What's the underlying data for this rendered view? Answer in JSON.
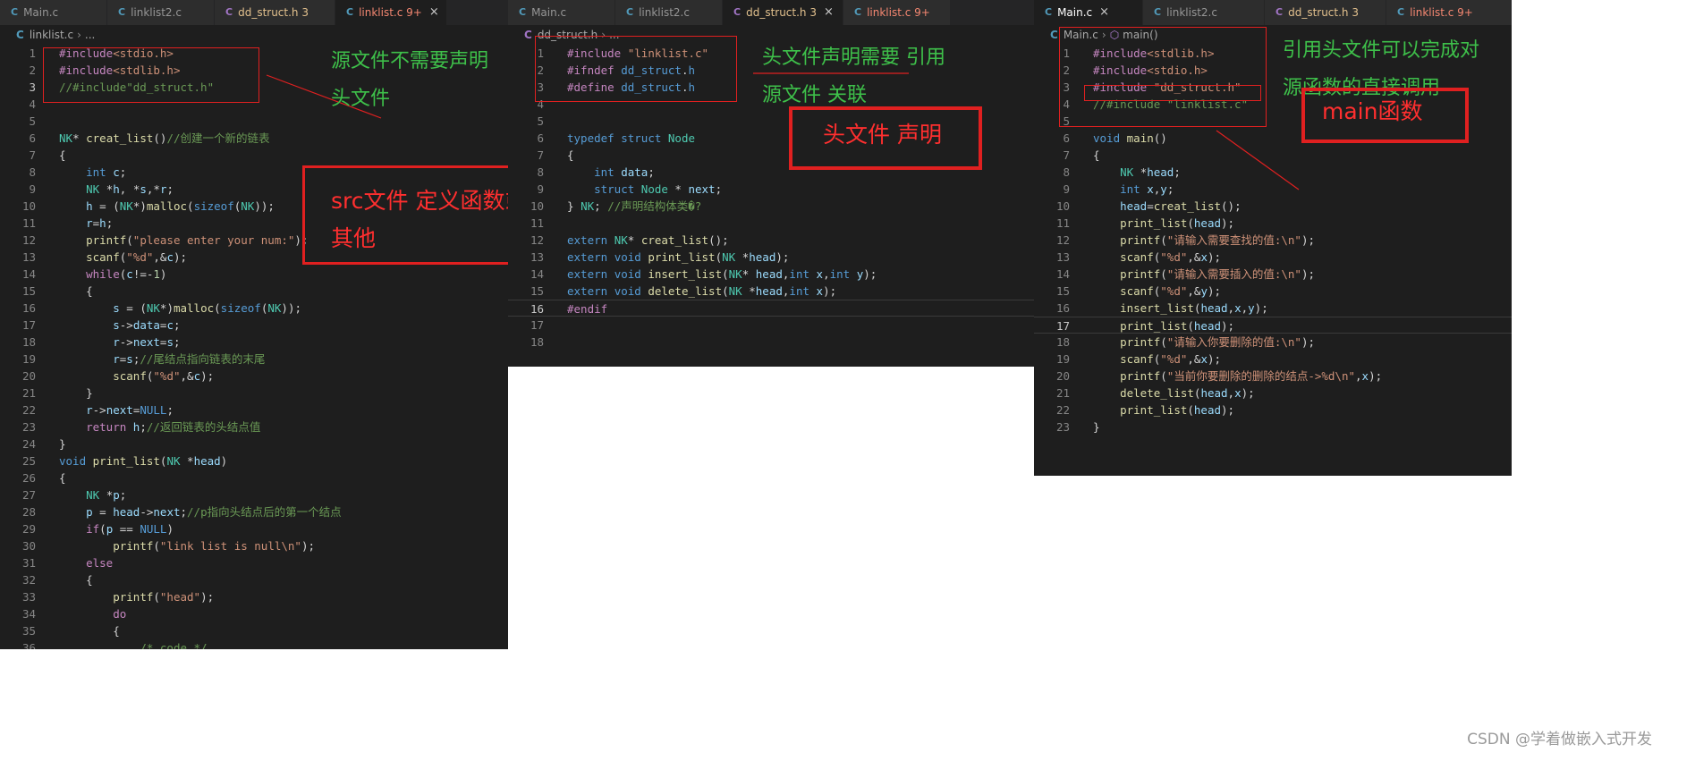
{
  "panel1": {
    "tabs": [
      {
        "label": "Main.c",
        "icon": "C",
        "color": "#969696"
      },
      {
        "label": "linklist2.c",
        "icon": "C",
        "color": "#969696"
      },
      {
        "label": "dd_struct.h 3",
        "icon": "C",
        "color": "#e2c08d"
      },
      {
        "label": "linklist.c 9+",
        "icon": "C",
        "color": "#f48771",
        "close": "×"
      }
    ],
    "crumbs": [
      "linklist.c",
      "..."
    ],
    "annotations": {
      "top": "源文件不需要声明",
      "top2": "头文件",
      "mid": "src文件 定义函数或",
      "mid2": "其他"
    }
  },
  "panel2": {
    "tabs": [
      {
        "label": "Main.c",
        "icon": "C",
        "color": "#969696"
      },
      {
        "label": "linklist2.c",
        "icon": "C",
        "color": "#969696"
      },
      {
        "label": "dd_struct.h 3",
        "icon": "C",
        "color": "#e2c08d",
        "close": "×"
      },
      {
        "label": "linklist.c 9+",
        "icon": "C",
        "color": "#f48771"
      }
    ],
    "crumbs": [
      "dd_struct.h",
      "..."
    ],
    "annotations": {
      "top": "头文件声明需要 引用",
      "top2": "源文件 关联",
      "box": "头文件 声明"
    }
  },
  "panel3": {
    "tabs": [
      {
        "label": "Main.c",
        "icon": "C",
        "color": "#ffffff",
        "close": "×"
      },
      {
        "label": "linklist2.c",
        "icon": "C",
        "color": "#969696"
      },
      {
        "label": "dd_struct.h 3",
        "icon": "C",
        "color": "#e2c08d"
      },
      {
        "label": "linklist.c 9+",
        "icon": "C",
        "color": "#f48771"
      }
    ],
    "crumbs": [
      "Main.c",
      "main()"
    ],
    "annotations": {
      "top": "引用头文件可以完成对",
      "top2": "源函数的直接调用",
      "box": "main函数"
    }
  },
  "watermark": "CSDN @学着做嵌入式开发"
}
